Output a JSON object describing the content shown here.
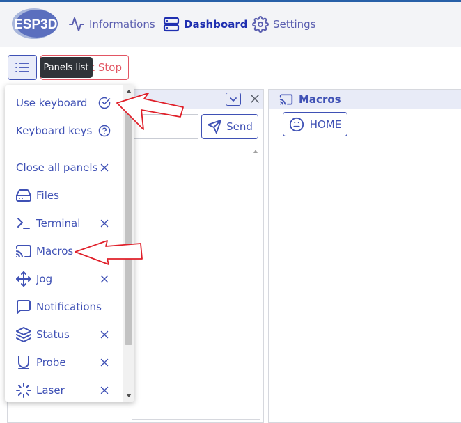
{
  "app": {
    "logo_text": "ESP3D",
    "brand_color": "#3f51b5",
    "accent_color": "#e25563"
  },
  "nav": {
    "items": [
      {
        "label": "Informations",
        "icon": "activity-icon"
      },
      {
        "label": "Dashboard",
        "icon": "dashboard-icon",
        "active": true
      },
      {
        "label": "Settings",
        "icon": "gear-icon"
      }
    ]
  },
  "toolbar": {
    "panels_list_icon": "list-icon",
    "estop_label": "k Stop",
    "tooltip": "Panels list"
  },
  "terminal": {
    "send_label": "Send",
    "input_value": ""
  },
  "macros_panel": {
    "title": "Macros",
    "buttons": [
      {
        "label": "HOME",
        "icon": "smile-icon"
      }
    ]
  },
  "dropdown": {
    "items": [
      {
        "label": "Use keyboard",
        "icon": "",
        "right_icon": "check-circle-icon"
      },
      {
        "label": "Keyboard keys",
        "icon": "",
        "right_icon": "help-circle-icon"
      },
      {
        "label": "Close all panels",
        "icon": "",
        "right_icon": "close-icon"
      },
      {
        "label": "Files",
        "icon": "hard-drive-icon",
        "right_icon": ""
      },
      {
        "label": "Terminal",
        "icon": "terminal-icon",
        "right_icon": "close-icon"
      },
      {
        "label": "Macros",
        "icon": "cast-icon",
        "right_icon": "close-icon"
      },
      {
        "label": "Jog",
        "icon": "move-icon",
        "right_icon": "close-icon"
      },
      {
        "label": "Notifications",
        "icon": "message-square-icon",
        "right_icon": ""
      },
      {
        "label": "Status",
        "icon": "layers-icon",
        "right_icon": "close-icon"
      },
      {
        "label": "Probe",
        "icon": "magnet-icon",
        "right_icon": "close-icon"
      },
      {
        "label": "Laser",
        "icon": "loader-icon",
        "right_icon": "close-icon"
      }
    ]
  }
}
